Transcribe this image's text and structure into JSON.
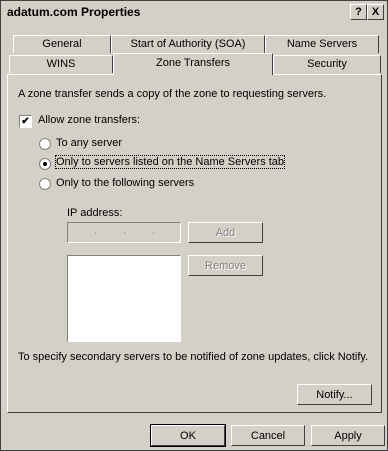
{
  "window": {
    "title": "adatum.com Properties",
    "help_glyph": "?",
    "close_glyph": "X"
  },
  "tabs": {
    "row1": [
      "General",
      "Start of Authority (SOA)",
      "Name Servers"
    ],
    "row2": [
      "WINS",
      "Zone Transfers",
      "Security"
    ],
    "active": "Zone Transfers"
  },
  "panel": {
    "description": "A zone transfer sends a copy of the zone to requesting servers.",
    "allow_label": "Allow zone transfers:",
    "allow_checked": true,
    "radio_any": "To any server",
    "radio_name_servers": "Only to servers listed on the Name Servers tab",
    "radio_following": "Only to the following servers",
    "selected_radio": "name_servers",
    "ip_label": "IP address:",
    "add_label": "Add",
    "remove_label": "Remove",
    "notify_text": "To specify secondary servers to be notified of zone updates, click Notify.",
    "notify_label": "Notify..."
  },
  "footer": {
    "ok_label": "OK",
    "cancel_label": "Cancel",
    "apply_label": "Apply"
  }
}
